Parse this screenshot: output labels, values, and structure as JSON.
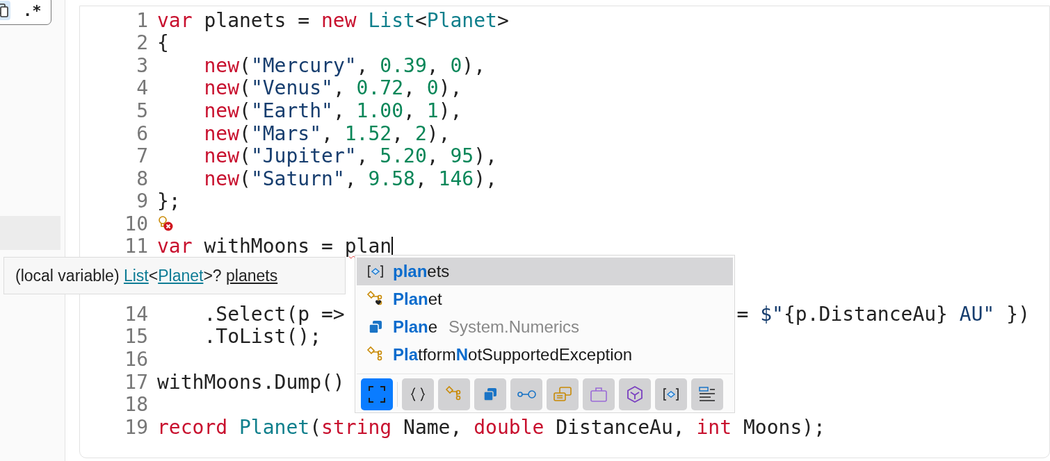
{
  "sidebar": {
    "toolbar": {
      "copy_selected": true,
      "regex_label": ".*"
    }
  },
  "editor": {
    "lines": [
      {
        "number": "1",
        "tokens": [
          {
            "t": "var",
            "kind": "kw"
          },
          {
            "t": " planets = ",
            "kind": "plain"
          },
          {
            "t": "new",
            "kind": "kw"
          },
          {
            "t": " List",
            "kind": "type"
          },
          {
            "t": "<",
            "kind": "plain"
          },
          {
            "t": "Planet",
            "kind": "type"
          },
          {
            "t": ">",
            "kind": "plain"
          }
        ]
      },
      {
        "number": "2",
        "tokens": [
          {
            "t": "{",
            "kind": "plain"
          }
        ]
      },
      {
        "number": "3",
        "tokens": [
          {
            "t": "    new",
            "kind": "kw"
          },
          {
            "t": "(",
            "kind": "plain"
          },
          {
            "t": "\"Mercury\"",
            "kind": "str"
          },
          {
            "t": ", ",
            "kind": "plain"
          },
          {
            "t": "0.39",
            "kind": "num"
          },
          {
            "t": ", ",
            "kind": "plain"
          },
          {
            "t": "0",
            "kind": "num"
          },
          {
            "t": "),",
            "kind": "plain"
          }
        ]
      },
      {
        "number": "4",
        "tokens": [
          {
            "t": "    new",
            "kind": "kw"
          },
          {
            "t": "(",
            "kind": "plain"
          },
          {
            "t": "\"Venus\"",
            "kind": "str"
          },
          {
            "t": ", ",
            "kind": "plain"
          },
          {
            "t": "0.72",
            "kind": "num"
          },
          {
            "t": ", ",
            "kind": "plain"
          },
          {
            "t": "0",
            "kind": "num"
          },
          {
            "t": "),",
            "kind": "plain"
          }
        ]
      },
      {
        "number": "5",
        "tokens": [
          {
            "t": "    new",
            "kind": "kw"
          },
          {
            "t": "(",
            "kind": "plain"
          },
          {
            "t": "\"Earth\"",
            "kind": "str"
          },
          {
            "t": ", ",
            "kind": "plain"
          },
          {
            "t": "1.00",
            "kind": "num"
          },
          {
            "t": ", ",
            "kind": "plain"
          },
          {
            "t": "1",
            "kind": "num"
          },
          {
            "t": "),",
            "kind": "plain"
          }
        ]
      },
      {
        "number": "6",
        "tokens": [
          {
            "t": "    new",
            "kind": "kw"
          },
          {
            "t": "(",
            "kind": "plain"
          },
          {
            "t": "\"Mars\"",
            "kind": "str"
          },
          {
            "t": ", ",
            "kind": "plain"
          },
          {
            "t": "1.52",
            "kind": "num"
          },
          {
            "t": ", ",
            "kind": "plain"
          },
          {
            "t": "2",
            "kind": "num"
          },
          {
            "t": "),",
            "kind": "plain"
          }
        ]
      },
      {
        "number": "7",
        "tokens": [
          {
            "t": "    new",
            "kind": "kw"
          },
          {
            "t": "(",
            "kind": "plain"
          },
          {
            "t": "\"Jupiter\"",
            "kind": "str"
          },
          {
            "t": ", ",
            "kind": "plain"
          },
          {
            "t": "5.20",
            "kind": "num"
          },
          {
            "t": ", ",
            "kind": "plain"
          },
          {
            "t": "95",
            "kind": "num"
          },
          {
            "t": "),",
            "kind": "plain"
          }
        ]
      },
      {
        "number": "8",
        "tokens": [
          {
            "t": "    new",
            "kind": "kw"
          },
          {
            "t": "(",
            "kind": "plain"
          },
          {
            "t": "\"Saturn\"",
            "kind": "str"
          },
          {
            "t": ", ",
            "kind": "plain"
          },
          {
            "t": "9.58",
            "kind": "num"
          },
          {
            "t": ", ",
            "kind": "plain"
          },
          {
            "t": "146",
            "kind": "num"
          },
          {
            "t": "),",
            "kind": "plain"
          }
        ]
      },
      {
        "number": "9",
        "tokens": [
          {
            "t": "};",
            "kind": "plain"
          }
        ]
      },
      {
        "number": "10",
        "lightbulb_error": true
      },
      {
        "number": "11",
        "tokens": [
          {
            "t": "var",
            "kind": "kw"
          },
          {
            "t": " withMoons = ",
            "kind": "plain"
          }
        ],
        "typed": "plan",
        "cursor": true
      },
      {
        "number": "14",
        "tokens": [
          {
            "t": "    .Select(p =>",
            "kind": "plain"
          }
        ],
        "tail": [
          {
            "t": "= ",
            "kind": "plain"
          },
          {
            "t": "$\"",
            "kind": "str"
          },
          {
            "t": "{p.DistanceAu}",
            "kind": "plain"
          },
          {
            "t": " AU\"",
            "kind": "str"
          },
          {
            "t": " })",
            "kind": "plain"
          }
        ]
      },
      {
        "number": "15",
        "tokens": [
          {
            "t": "    .ToList();",
            "kind": "plain"
          }
        ]
      },
      {
        "number": "16"
      },
      {
        "number": "17",
        "tokens": [
          {
            "t": "withMoons.Dump()",
            "kind": "plain"
          }
        ]
      },
      {
        "number": "18"
      },
      {
        "number": "19",
        "tokens": [
          {
            "t": "record",
            "kind": "kw"
          },
          {
            "t": " Planet",
            "kind": "type"
          },
          {
            "t": "(",
            "kind": "plain"
          },
          {
            "t": "string",
            "kind": "kw"
          },
          {
            "t": " Name, ",
            "kind": "plain"
          },
          {
            "t": "double",
            "kind": "kw"
          },
          {
            "t": " DistanceAu, ",
            "kind": "plain"
          },
          {
            "t": "int",
            "kind": "kw"
          },
          {
            "t": " Moons);",
            "kind": "plain"
          }
        ]
      }
    ]
  },
  "tooltip": {
    "parts": [
      {
        "t": "(local variable) ",
        "link": false
      },
      {
        "t": "List",
        "link": true
      },
      {
        "t": "<",
        "link": false
      },
      {
        "t": "Planet",
        "link": true
      },
      {
        "t": ">? ",
        "link": false
      },
      {
        "t": "planets",
        "link": false,
        "underline": true
      }
    ]
  },
  "completion": {
    "items": [
      {
        "kind": "variable",
        "selected": true,
        "parts": [
          {
            "t": "plan",
            "match": true
          },
          {
            "t": "ets",
            "match": false
          }
        ]
      },
      {
        "kind": "record",
        "selected": false,
        "parts": [
          {
            "t": "Plan",
            "match": true
          },
          {
            "t": "et",
            "match": false
          }
        ]
      },
      {
        "kind": "struct",
        "selected": false,
        "parts": [
          {
            "t": "Plan",
            "match": true
          },
          {
            "t": "e",
            "match": false
          }
        ],
        "detail": "System.Numerics"
      },
      {
        "kind": "class",
        "selected": false,
        "parts": [
          {
            "t": "Pla",
            "match": true
          },
          {
            "t": "tform",
            "match": false
          },
          {
            "t": "N",
            "match": true
          },
          {
            "t": "otSupportedException",
            "match": false
          }
        ]
      }
    ],
    "filters": [
      {
        "kind": "all",
        "selected": true
      },
      {
        "kind": "namespace",
        "selected": false
      },
      {
        "kind": "class",
        "selected": false
      },
      {
        "kind": "struct",
        "selected": false
      },
      {
        "kind": "interface",
        "selected": false
      },
      {
        "kind": "enum",
        "selected": false
      },
      {
        "kind": "module",
        "selected": false
      },
      {
        "kind": "cube",
        "selected": false
      },
      {
        "kind": "variable",
        "selected": false
      },
      {
        "kind": "snippet",
        "selected": false
      }
    ]
  }
}
